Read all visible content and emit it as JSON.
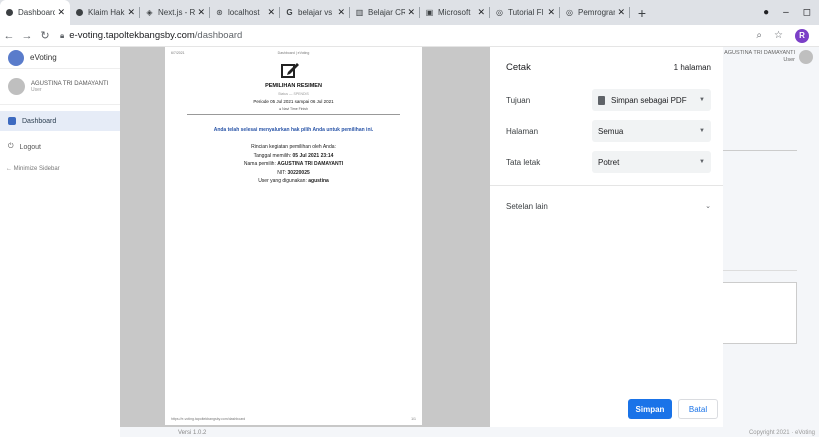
{
  "browser": {
    "tabs": [
      {
        "title": "Dashboard",
        "icon": "circle-icon",
        "active": true
      },
      {
        "title": "Klaim Hak",
        "icon": "circle-icon",
        "active": false
      },
      {
        "title": "Next.js - R",
        "icon": "diamond-icon",
        "active": false
      },
      {
        "title": "localhost",
        "icon": "globe-icon",
        "active": false
      },
      {
        "title": "belajar vs",
        "icon": "google-icon",
        "active": false
      },
      {
        "title": "Belajar CR",
        "icon": "building-icon",
        "active": false
      },
      {
        "title": "Microsoft",
        "icon": "document-icon",
        "active": false
      },
      {
        "title": "Tutorial Fl",
        "icon": "ring-icon",
        "active": false
      },
      {
        "title": "Pemrogram",
        "icon": "ring-icon",
        "active": false
      }
    ],
    "new_tab": "+",
    "window_controls": {
      "minimize": "–",
      "maximize": "◻"
    },
    "url_host": "e-voting.tapoltekbangsby.com",
    "url_path": "/dashboard",
    "profile_initial": "R"
  },
  "app": {
    "brand": "eVoting",
    "user_name": "AGUSTINA TRI DAMAYANTI",
    "user_role": "User",
    "nav_dashboard": "Dashboard",
    "nav_logout": "Logout",
    "minimize_sidebar": "← Minimize Sidebar",
    "top_user_name": "AGUSTINA TRI DAMAYANTI",
    "top_user_role": "User",
    "version": "Versi 1.0.2",
    "copyright": "Copyright 2021 · eVoting"
  },
  "preview": {
    "header_left": "6/7/2021",
    "header_center": "Dashboard | eVoting",
    "title": "PEMILIHAN RESIMEN",
    "status": "Status — SPENDIS",
    "periode": "Periode 05 Jul 2021 sampai 06 Jul 2021",
    "nav_time": "Navi Time Finish",
    "message": "Anda telah selesai menyalurkan hak pilih Anda untuk pemilihan ini.",
    "rincian_label": "Rincian kegiatan pemilihan oleh Anda:",
    "tanggal_label": "Tanggal memilih: ",
    "tanggal_value": "05 Jul 2021 23:14",
    "nama_label": "Nama pemilih: ",
    "nama_value": "AGUSTINA TRI DAMAYANTI",
    "nit_label": "NIT: ",
    "nit_value": "30220025",
    "username_label": "User yang digunakan: ",
    "username_value": "agustina",
    "footer_left": "https://e-voting.tapoltekbangsby.com/dashboard",
    "footer_right": "1/1"
  },
  "print_dialog": {
    "title": "Cetak",
    "page_count": "1 halaman",
    "destination_label": "Tujuan",
    "destination_value": "Simpan sebagai PDF",
    "pages_label": "Halaman",
    "pages_value": "Semua",
    "layout_label": "Tata letak",
    "layout_value": "Potret",
    "more_settings": "Setelan lain",
    "save_button": "Simpan",
    "cancel_button": "Batal"
  },
  "colors": {
    "accent": "#1a73e8",
    "message_blue": "#2a55a8"
  }
}
